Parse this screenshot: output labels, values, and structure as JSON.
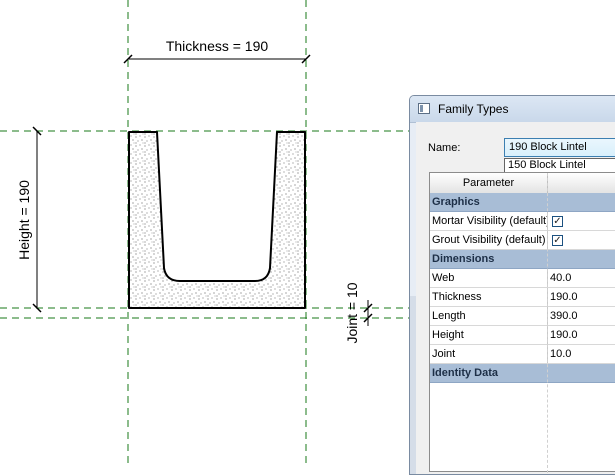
{
  "drawing": {
    "thickness_dim": "Thickness = 190",
    "height_dim": "Height = 190",
    "joint_dim": "Joint = 10"
  },
  "dialog": {
    "title": "Family Types",
    "name_label": "Name:",
    "name_value": "190 Block Lintel",
    "dropdown_options": [
      "150 Block Lintel",
      "190 Block Lintel"
    ],
    "selected_option": "190 Block Lintel",
    "grid": {
      "header_parameter": "Parameter",
      "groups": [
        {
          "name": "Graphics",
          "params": [
            {
              "name": "Mortar Visibility (default)",
              "checked": true
            },
            {
              "name": "Grout Visibility (default)",
              "checked": true
            }
          ]
        },
        {
          "name": "Dimensions",
          "params": [
            {
              "name": "Web",
              "value": "40.0"
            },
            {
              "name": "Thickness",
              "value": "190.0"
            },
            {
              "name": "Length",
              "value": "390.0"
            },
            {
              "name": "Height",
              "value": "190.0"
            },
            {
              "name": "Joint",
              "value": "10.0"
            }
          ]
        },
        {
          "name": "Identity Data",
          "params": []
        }
      ]
    }
  },
  "colors": {
    "reference_line": "#1a7a1a",
    "group_header_bg": "#a8bdd6",
    "selection": "#3399ff"
  }
}
